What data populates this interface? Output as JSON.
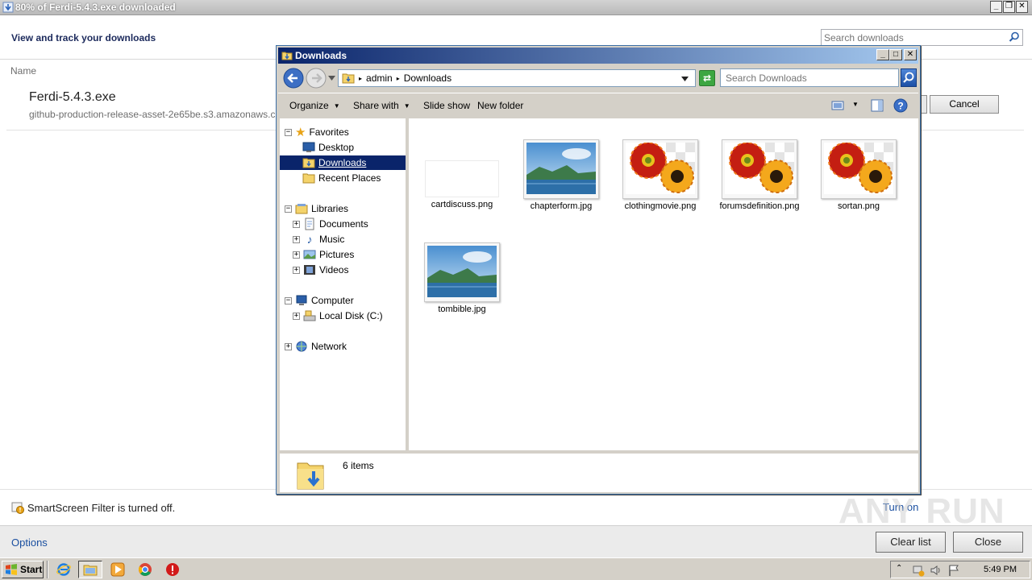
{
  "download_manager": {
    "window_title": "80% of Ferdi-5.4.3.exe downloaded",
    "heading": "View and track your downloads",
    "search_placeholder": "Search downloads",
    "column_name": "Name",
    "item": {
      "file_name": "Ferdi-5.4.3.exe",
      "source": "github-production-release-asset-2e65be.s3.amazonaws.com",
      "progress_percent": 80,
      "cancel_label": "Cancel"
    },
    "smartscreen_text": "SmartScreen Filter is turned off.",
    "turn_on_label": "Turn on",
    "options_label": "Options",
    "clear_list_label": "Clear list",
    "close_label": "Close"
  },
  "explorer": {
    "title": "Downloads",
    "breadcrumb": [
      "admin",
      "Downloads"
    ],
    "search_placeholder": "Search Downloads",
    "toolbar": {
      "organize": "Organize",
      "share_with": "Share with",
      "slide_show": "Slide show",
      "new_folder": "New folder"
    },
    "nav_tree": {
      "favorites": "Favorites",
      "desktop": "Desktop",
      "downloads": "Downloads",
      "recent_places": "Recent Places",
      "libraries": "Libraries",
      "documents": "Documents",
      "music": "Music",
      "pictures": "Pictures",
      "videos": "Videos",
      "computer": "Computer",
      "local_disk": "Local Disk (C:)",
      "network": "Network"
    },
    "files": [
      {
        "name": "cartdiscuss.png",
        "thumb": "blank"
      },
      {
        "name": "chapterform.jpg",
        "thumb": "landscape"
      },
      {
        "name": "clothingmovie.png",
        "thumb": "flowers"
      },
      {
        "name": "forumsdefinition.png",
        "thumb": "flowers"
      },
      {
        "name": "sortan.png",
        "thumb": "flowers"
      },
      {
        "name": "tombible.jpg",
        "thumb": "landscape"
      }
    ],
    "item_count": "6 items"
  },
  "taskbar": {
    "start_label": "Start",
    "clock": "5:49 PM"
  },
  "watermark": "ANY RUN"
}
